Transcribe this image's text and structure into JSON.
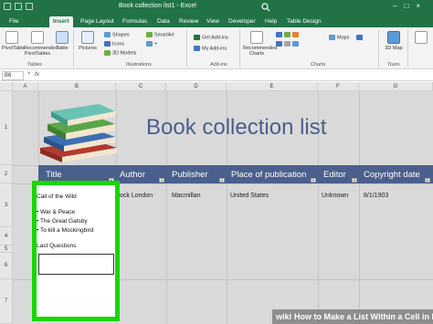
{
  "window": {
    "title": "Book collection list1  -  Excel"
  },
  "ribbon_tabs": [
    "File",
    "Insert",
    "Page Layout",
    "Formulas",
    "Data",
    "Review",
    "View",
    "Developer",
    "Help",
    "Table Design"
  ],
  "active_tab": "Insert",
  "ribbon": {
    "pivottable": "PivotTable",
    "recommended_pivottables": "Recommended PivotTables",
    "table": "Table",
    "pictures": "Pictures",
    "shapes": "Shapes",
    "icons": "Icons",
    "models_3d": "3D Models",
    "smartart": "SmartArt",
    "screenshot": "+",
    "get_addins": "Get Add-ins",
    "my_addins": "My Add-ins",
    "recommended_charts": "Recommended Charts",
    "map": "Maps",
    "map_3d": "3D Map",
    "groups": {
      "tables": "Tables",
      "illustrations": "Illustrations",
      "addins": "Add-ins",
      "charts": "Charts",
      "tours": "Tours"
    }
  },
  "formula_bar": {
    "name_box": "B6",
    "fx": "fx",
    "cancel": "×"
  },
  "columns": [
    "A",
    "B",
    "C",
    "D",
    "E",
    "F",
    "G"
  ],
  "rows": [
    "1",
    "2",
    "3",
    "4",
    "5",
    "6",
    "7"
  ],
  "sheet": {
    "title": "Book collection list",
    "headers": [
      "Title",
      "Author",
      "Publisher",
      "Place of publication",
      "Editor",
      "Copyright date"
    ],
    "row3": {
      "author": "ock London",
      "publisher": "Macmillan",
      "place": "United States",
      "editor": "Unknown",
      "date": "8/1/1903"
    },
    "list_cell": {
      "first": "Call of the Wild",
      "bullets": [
        "• War & Peace",
        "• The Great Gatsby",
        "• To kill a Mockingbird"
      ],
      "last": "Last Questions"
    }
  },
  "watermark": {
    "wiki": "wiki",
    "text": "How to Make a List Within a Cell in Excel"
  },
  "colors": {
    "excel_green": "#217346",
    "header_blue": "#4a5f8c",
    "highlight_green": "#19d600"
  }
}
